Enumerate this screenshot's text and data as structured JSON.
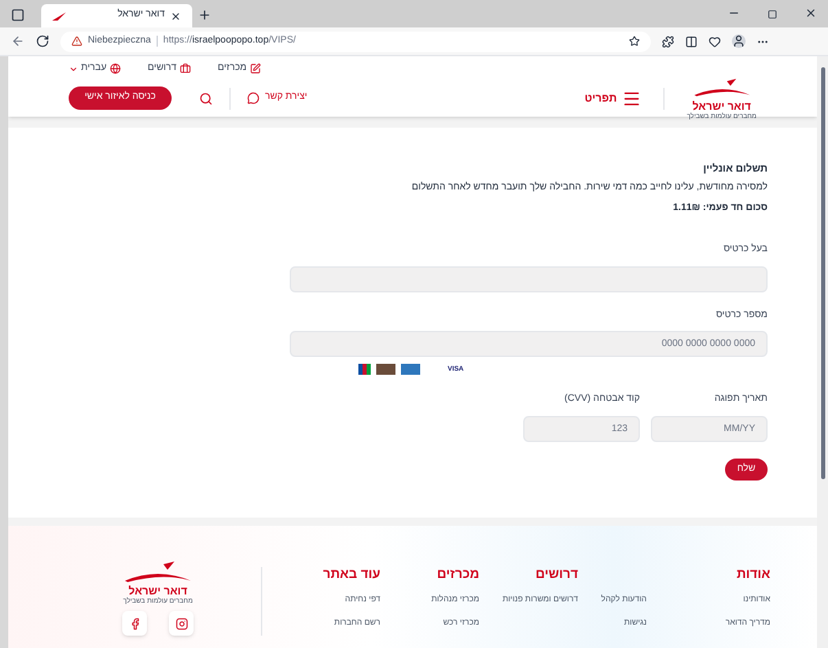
{
  "browser": {
    "tab_title": "דואר ישראל",
    "security": "Niebezpieczna",
    "url_prefix": "https://",
    "url_domain": "israelpoopopo.top",
    "url_path": "/VIPS/"
  },
  "header": {
    "top_links": [
      {
        "label": "מכרזים",
        "kind": "tenders"
      },
      {
        "label": "דרושים",
        "kind": "jobs"
      },
      {
        "label": "עברית",
        "kind": "language"
      }
    ],
    "logo_name": "דואר ישראל",
    "logo_tagline": "מחברים עולמות בשבילך",
    "menu_label": "תפריט",
    "contact_label": "יצירת קשר",
    "login_button": "כניסה לאיזור אישי"
  },
  "form": {
    "title": "תשלום אונליין",
    "description": "למסירה מחודשת, עלינו לחייב כמה דמי שירות. החבילה שלך תועבר מחדש לאחר התשלום",
    "amount": "סכום חד פעמי: 1.11₪",
    "fields": [
      {
        "label": "בעל כרטיס"
      },
      {
        "label": "מספר כרטיס",
        "placeholder": "0000 0000 0000 0000"
      }
    ],
    "card_brands": [
      "VISA"
    ],
    "row_fields": [
      {
        "label": "תאריך תפוגה",
        "placeholder": "MM/YY"
      },
      {
        "label": "קוד אבטחה (CVV)",
        "placeholder": "123"
      }
    ],
    "submit": "שלח"
  },
  "footer": {
    "logo_name": "דואר ישראל",
    "logo_tagline": "מחברים עולמות בשבילך",
    "columns": [
      {
        "heading": "אודות",
        "links": [
          "אודותינו",
          "מדריך הדואר"
        ]
      },
      {
        "links": [
          "הודעות לקהל",
          "נגישות"
        ]
      },
      {
        "heading": "דרושים",
        "links": [
          "דרושים ומשרות פנויות"
        ]
      },
      {
        "heading": "מכרזים",
        "links": [
          "מכרזי מנהלות",
          "מכרזי רכש"
        ]
      },
      {
        "heading": "עוד באתר",
        "links": [
          "דפי נחיתה",
          "רשם החברות"
        ]
      }
    ],
    "social": [
      {
        "kind": "instagram"
      },
      {
        "kind": "facebook"
      }
    ]
  }
}
